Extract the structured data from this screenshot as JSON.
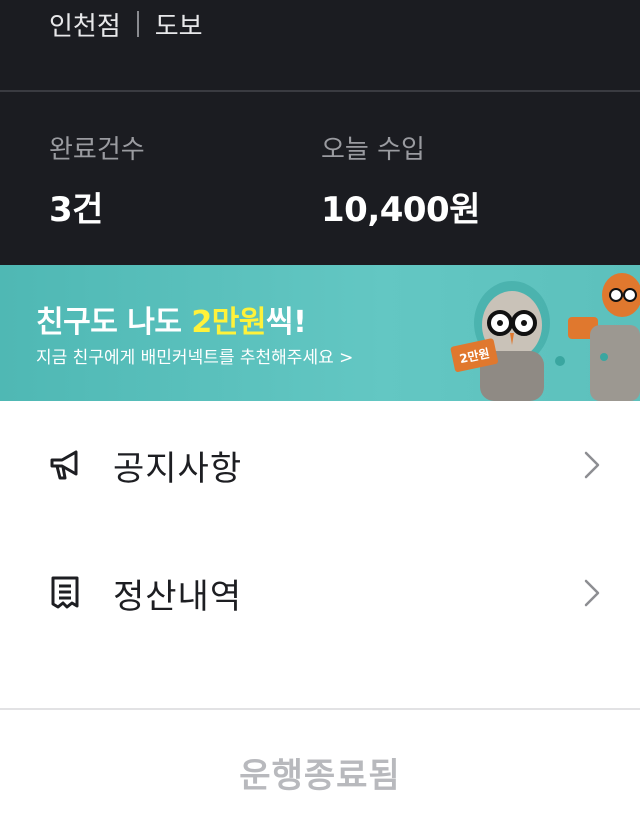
{
  "header": {
    "branch": "인천점",
    "delivery_mode": "도보",
    "stats": {
      "completed_label": "완료건수",
      "completed_value": "3건",
      "income_label": "오늘 수입",
      "income_value": "10,400원"
    }
  },
  "banner": {
    "title_pre": "친구도 나도 ",
    "title_highlight": "2만원",
    "title_post": "씩!",
    "subtitle": "지금 친구에게 배민커넥트를 추천해주세요 >",
    "art_badge": "2만원"
  },
  "menu": {
    "items": [
      {
        "label": "공지사항",
        "icon": "megaphone-icon"
      },
      {
        "label": "정산내역",
        "icon": "receipt-icon"
      }
    ]
  },
  "footer": {
    "button_label": "운행종료됨"
  },
  "colors": {
    "header_bg": "#1b1c21",
    "banner_bg": "#5cc0bc",
    "highlight": "#fff23a",
    "disabled_text": "#b8b9bd"
  }
}
